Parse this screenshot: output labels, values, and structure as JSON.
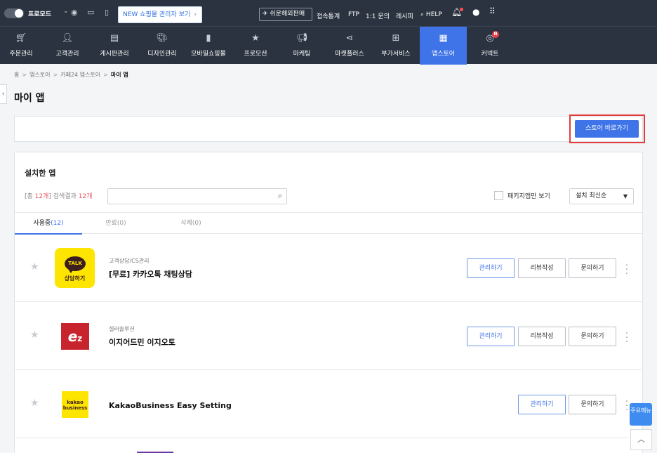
{
  "topbar": {
    "mode_label": "프로모드",
    "new_admin_button": "NEW 쇼핑몰 관리자 보기",
    "overseas_button": "쉬운해외판매",
    "links": [
      "접속통계",
      "FTP",
      "1:1 문의",
      "레시피"
    ],
    "help_label": "HELP"
  },
  "nav": {
    "items": [
      {
        "label": "주문관리",
        "icon": "cart-icon"
      },
      {
        "label": "고객관리",
        "icon": "user-icon"
      },
      {
        "label": "게시판관리",
        "icon": "board-icon"
      },
      {
        "label": "디자인관리",
        "icon": "palette-icon"
      },
      {
        "label": "모바일쇼핑몰",
        "icon": "mobile-icon"
      },
      {
        "label": "프로모션",
        "icon": "star-icon"
      },
      {
        "label": "마케팅",
        "icon": "megaphone-icon"
      },
      {
        "label": "마켓플러스",
        "icon": "share-icon"
      },
      {
        "label": "부가서비스",
        "icon": "folder-plus-icon"
      },
      {
        "label": "앱스토어",
        "icon": "apps-grid-icon"
      },
      {
        "label": "커넥트",
        "icon": "connect-icon"
      }
    ],
    "active_index": 9,
    "connect_badge": "N"
  },
  "breadcrumb": {
    "home": "홈",
    "level1": "앱스토어",
    "level2": "카페24 앱스토어",
    "current": "마이 앱"
  },
  "page_title": "마이 앱",
  "store_button": "스토어 바로가기",
  "section": {
    "title": "설치한 앱",
    "count_prefix": "[총 ",
    "total_count": "12개",
    "count_middle": "] 검색결과 ",
    "result_count": "12개",
    "search_placeholder": "",
    "package_only_label": "패키지앱만 보기",
    "sort_selected": "설치 최신순"
  },
  "tabs": [
    {
      "label": "사용중",
      "count": "(12)"
    },
    {
      "label": "만료",
      "count": "(0)"
    },
    {
      "label": "삭제",
      "count": "(0)"
    }
  ],
  "apps": [
    {
      "category": "고객상담/CS관리",
      "name": "[무료] 카카오톡 채팅상담",
      "logo_text": "TALK",
      "logo_sub": "상담하기"
    },
    {
      "category": "셀러솔루션",
      "name": "이지어드민 이지오토",
      "logo_text": "e",
      "logo_sub": "z"
    },
    {
      "category": "",
      "name": "KakaoBusiness Easy Setting",
      "logo_text": "kakao",
      "logo_sub": "business"
    }
  ],
  "row_buttons": {
    "manage": "관리하기",
    "review": "리뷰작성",
    "inquiry": "문의하기"
  },
  "floating": {
    "main_menu": "주요메뉴"
  },
  "colors": {
    "header_bg": "#2b3340",
    "accent": "#3f73e8",
    "highlight_frame": "#e23c3c",
    "count_red": "#e8555f"
  }
}
